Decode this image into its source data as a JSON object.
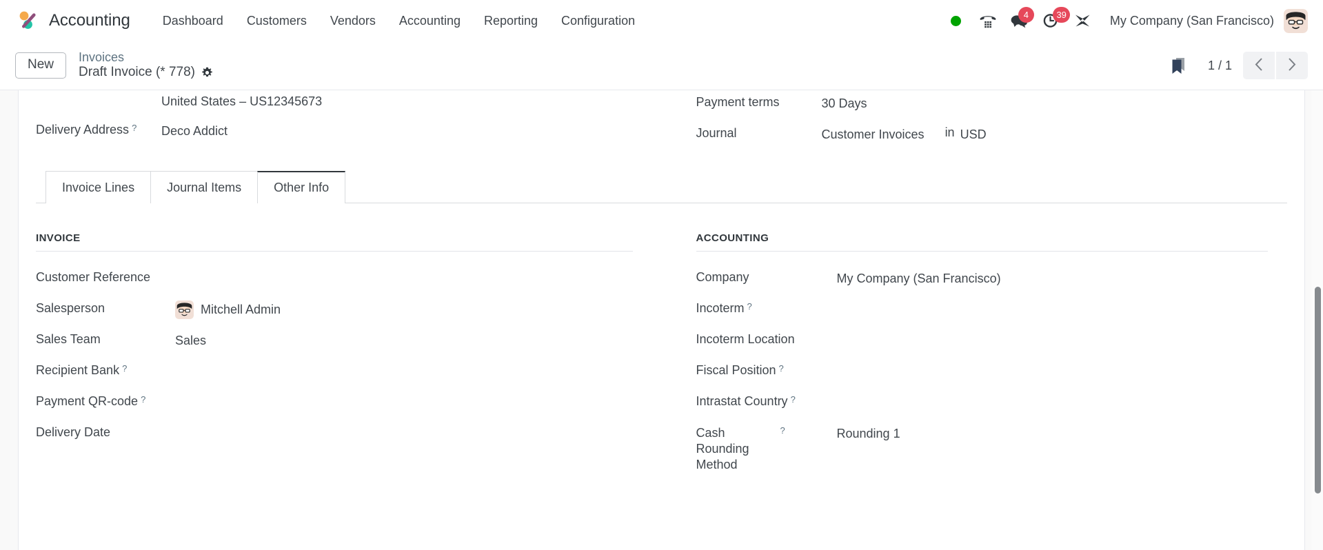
{
  "navbar": {
    "brand": "Accounting",
    "brand_logo_icon": "odoo-accounting-logo-icon",
    "menu": [
      {
        "label": "Dashboard",
        "name": "nav-dashboard"
      },
      {
        "label": "Customers",
        "name": "nav-customers"
      },
      {
        "label": "Vendors",
        "name": "nav-vendors"
      },
      {
        "label": "Accounting",
        "name": "nav-accounting"
      },
      {
        "label": "Reporting",
        "name": "nav-reporting"
      },
      {
        "label": "Configuration",
        "name": "nav-configuration"
      }
    ],
    "systray": {
      "presence_icon": "presence-online-dot-icon",
      "presence_color": "#00a300",
      "voip_icon": "phone-dialpad-icon",
      "messages_icon": "messages-bubble-icon",
      "messages_count": "4",
      "activities_icon": "activities-clock-icon",
      "activities_count": "39",
      "debug_icon": "developer-tools-icon",
      "badge_color": "#e6485a"
    },
    "company": "My Company (San Francisco)",
    "user_avatar_icon": "user-avatar-icon"
  },
  "control_panel": {
    "new_label": "New",
    "breadcrumb_parent": "Invoices",
    "breadcrumb_current": "Draft Invoice (* 778)",
    "settings_icon": "gear-icon",
    "bookmark_icon": "bookmark-icon",
    "pager": "1 / 1",
    "prev_icon": "chevron-left-icon",
    "next_icon": "chevron-right-icon"
  },
  "header_form": {
    "left": {
      "tax_id_value": "United States – US12345673",
      "delivery_address_label": "Delivery Address",
      "delivery_address_value": "Deco Addict",
      "help_marker": "?"
    },
    "right": {
      "payment_terms_label": "Payment terms",
      "payment_terms_value": "30 Days",
      "journal_label": "Journal",
      "journal_value": "Customer Invoices",
      "currency_separator": "in",
      "currency_value": "USD"
    }
  },
  "notebook": {
    "tabs": [
      {
        "label": "Invoice Lines",
        "name": "tab-invoice-lines",
        "active": false
      },
      {
        "label": "Journal Items",
        "name": "tab-journal-items",
        "active": false
      },
      {
        "label": "Other Info",
        "name": "tab-other-info",
        "active": true
      }
    ]
  },
  "other_info": {
    "invoice_group": {
      "title": "INVOICE",
      "fields": [
        {
          "label": "Customer Reference",
          "value": "",
          "help": false
        },
        {
          "label": "Salesperson",
          "value": "Mitchell Admin",
          "help": false,
          "avatar": "user-avatar-icon"
        },
        {
          "label": "Sales Team",
          "value": "Sales",
          "help": false
        },
        {
          "label": "Recipient Bank",
          "value": "",
          "help": true
        },
        {
          "label": "Payment QR-code",
          "value": "",
          "help": true
        },
        {
          "label": "Delivery Date",
          "value": "",
          "help": false
        }
      ]
    },
    "accounting_group": {
      "title": "ACCOUNTING",
      "fields": [
        {
          "label": "Company",
          "value": "My Company (San Francisco)",
          "help": false
        },
        {
          "label": "Incoterm",
          "value": "",
          "help": true
        },
        {
          "label": "Incoterm Location",
          "value": "",
          "help": false
        },
        {
          "label": "Fiscal Position",
          "value": "",
          "help": true
        },
        {
          "label": "Intrastat Country",
          "value": "",
          "help": true
        },
        {
          "label": "Cash Rounding Method",
          "value": "Rounding 1",
          "help": true
        }
      ]
    },
    "help_marker": "?"
  }
}
